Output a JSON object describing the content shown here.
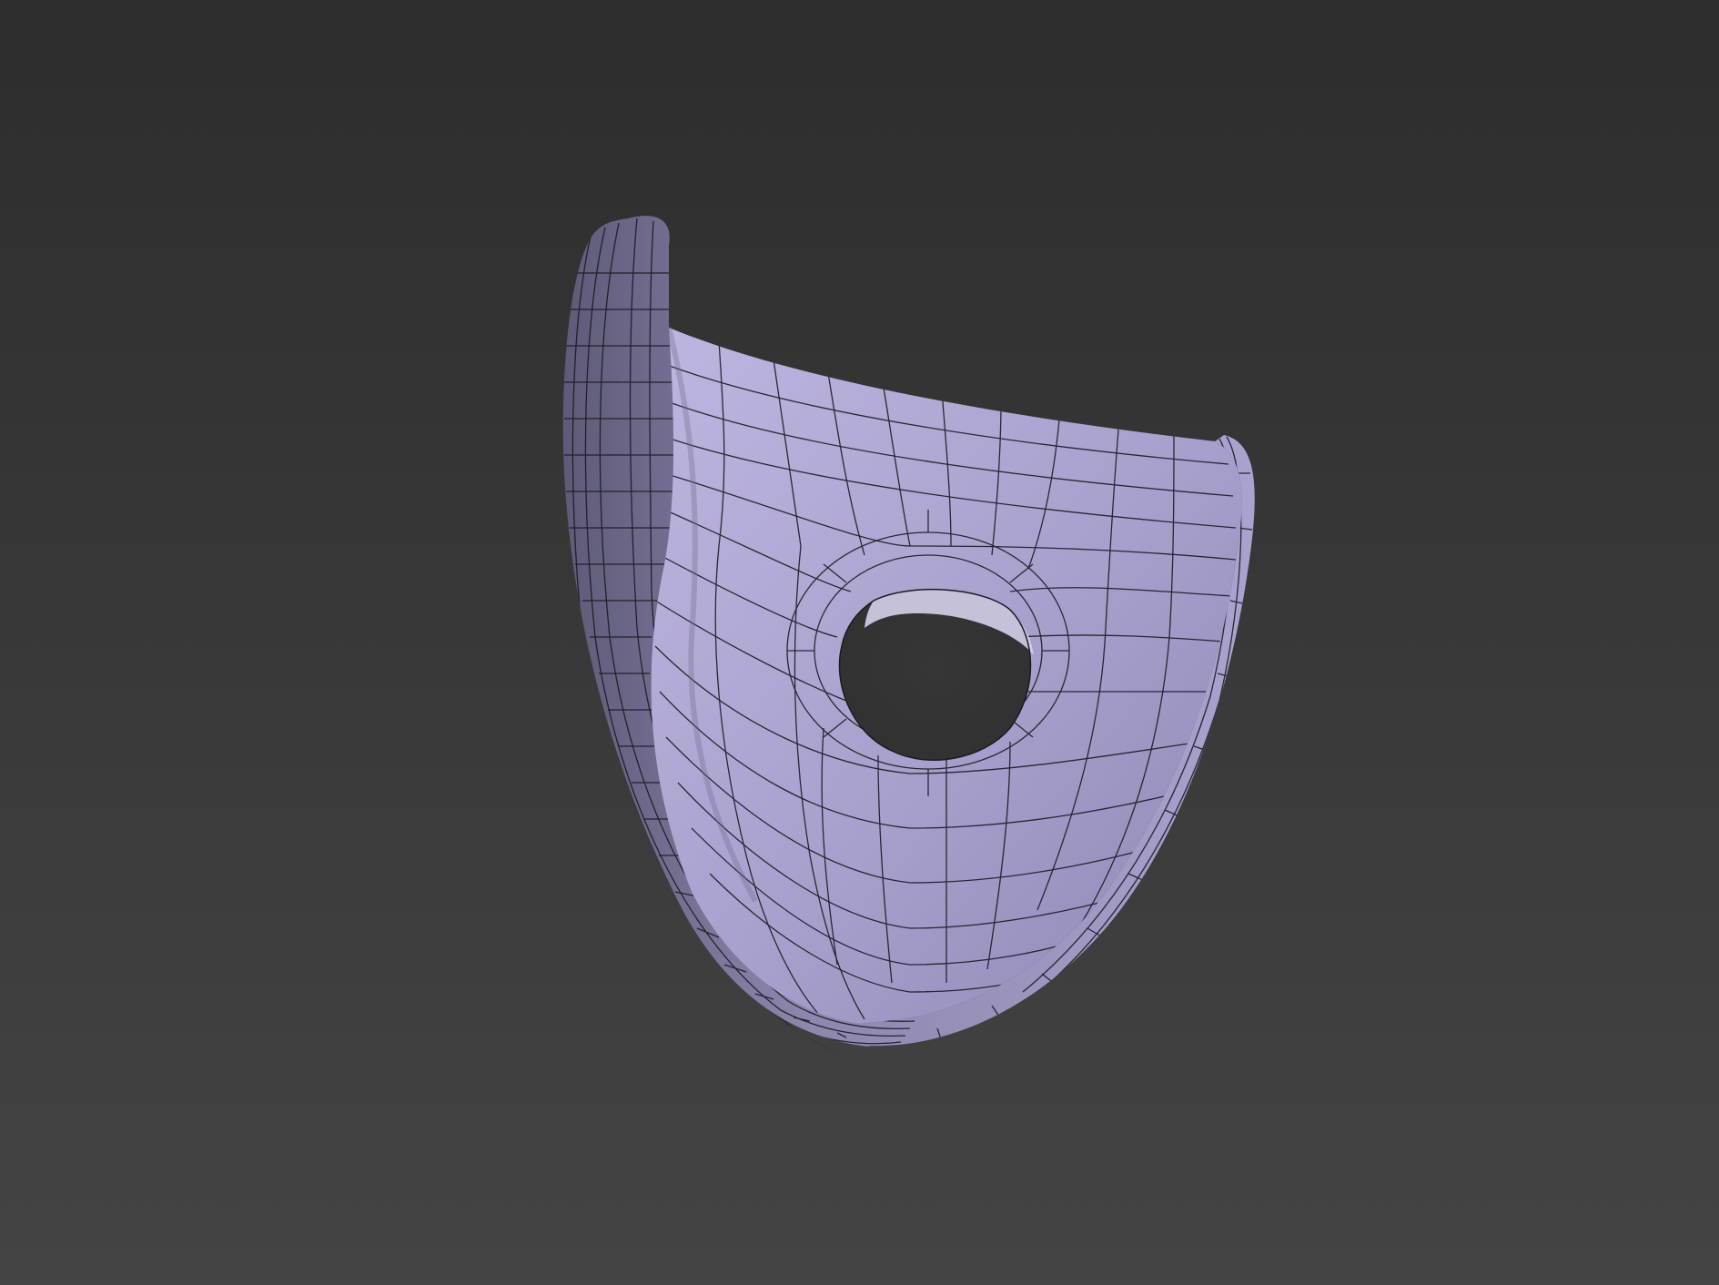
{
  "viewport": {
    "background_top": "#2d2d2d",
    "background_bottom": "#444444"
  },
  "model": {
    "surface_color": "#a59dc9",
    "surface_highlight": "#bcb6de",
    "surface_shadow": "#6f6a8c",
    "wire_color": "#1a1a22",
    "shading": "smooth-with-wireframe"
  }
}
